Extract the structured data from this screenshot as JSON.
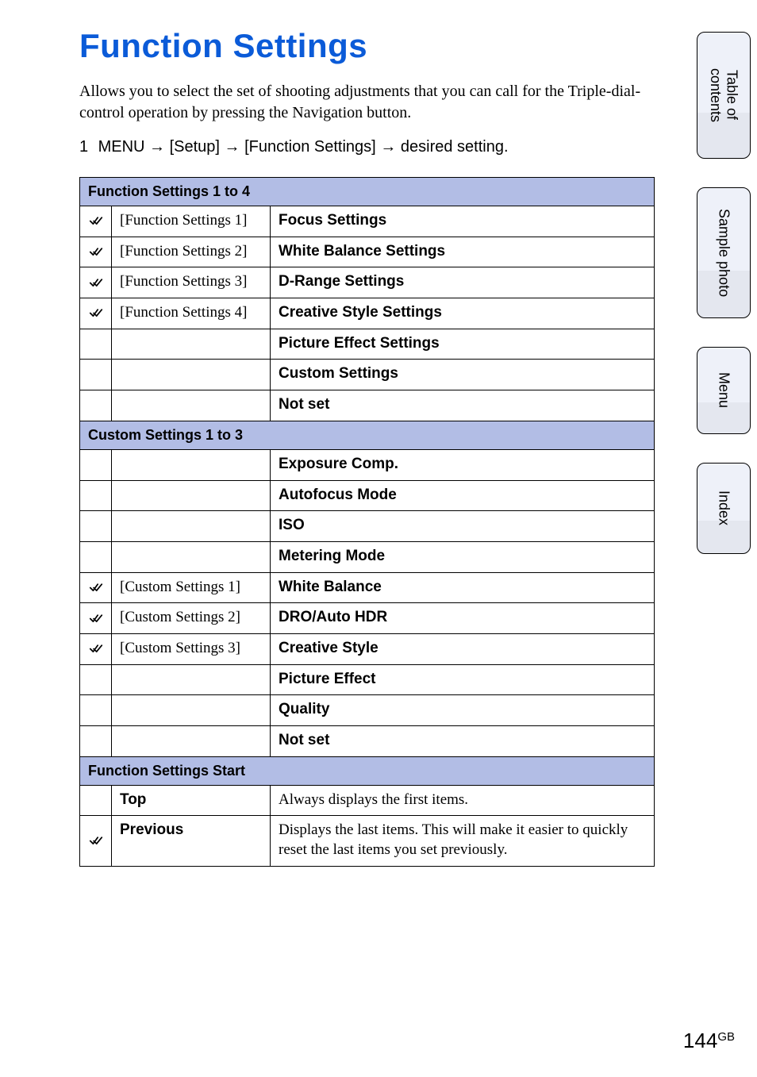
{
  "heading": "Function Settings",
  "intro": "Allows you to select the set of shooting adjustments that you can call for the Triple-dial-control operation by pressing the Navigation button.",
  "step": {
    "number": "1",
    "menu": "MENU",
    "arrow": "→",
    "setup": "[Setup]",
    "funcset": "[Function Settings]",
    "desired": "desired setting."
  },
  "sections": [
    {
      "title": "Function Settings 1 to 4",
      "rows": [
        {
          "check": true,
          "label": "[Function Settings 1]",
          "value": "Focus Settings",
          "label_style": "serif",
          "value_style": "bold"
        },
        {
          "check": true,
          "label": "[Function Settings 2]",
          "value": "White Balance Settings",
          "label_style": "serif",
          "value_style": "bold"
        },
        {
          "check": true,
          "label": "[Function Settings 3]",
          "value": "D-Range Settings",
          "label_style": "serif",
          "value_style": "bold"
        },
        {
          "check": true,
          "label": "[Function Settings 4]",
          "value": "Creative Style Settings",
          "label_style": "serif",
          "value_style": "bold"
        },
        {
          "check": false,
          "label": "",
          "value": "Picture Effect Settings",
          "label_style": "serif",
          "value_style": "bold"
        },
        {
          "check": false,
          "label": "",
          "value": "Custom Settings",
          "label_style": "serif",
          "value_style": "bold"
        },
        {
          "check": false,
          "label": "",
          "value": "Not set",
          "label_style": "serif",
          "value_style": "bold"
        }
      ]
    },
    {
      "title": "Custom Settings 1 to 3",
      "rows": [
        {
          "check": false,
          "label": "",
          "value": "Exposure Comp.",
          "label_style": "serif",
          "value_style": "bold"
        },
        {
          "check": false,
          "label": "",
          "value": "Autofocus Mode",
          "label_style": "serif",
          "value_style": "bold"
        },
        {
          "check": false,
          "label": "",
          "value": "ISO",
          "label_style": "serif",
          "value_style": "bold"
        },
        {
          "check": false,
          "label": "",
          "value": "Metering Mode",
          "label_style": "serif",
          "value_style": "bold"
        },
        {
          "check": true,
          "label": "[Custom Settings 1]",
          "value": "White Balance",
          "label_style": "serif",
          "value_style": "bold"
        },
        {
          "check": true,
          "label": "[Custom Settings 2]",
          "value": "DRO/Auto HDR",
          "label_style": "serif",
          "value_style": "bold"
        },
        {
          "check": true,
          "label": "[Custom Settings 3]",
          "value": "Creative Style",
          "label_style": "serif",
          "value_style": "bold"
        },
        {
          "check": false,
          "label": "",
          "value": "Picture Effect",
          "label_style": "serif",
          "value_style": "bold"
        },
        {
          "check": false,
          "label": "",
          "value": "Quality",
          "label_style": "serif",
          "value_style": "bold"
        },
        {
          "check": false,
          "label": "",
          "value": "Not set",
          "label_style": "serif",
          "value_style": "bold"
        }
      ]
    },
    {
      "title": "Function Settings Start",
      "rows": [
        {
          "check": false,
          "label": "Top",
          "value": "Always displays the first items.",
          "label_style": "bold",
          "value_style": "serif"
        },
        {
          "check": true,
          "label": "Previous",
          "value": "Displays the last items. This will make it easier to quickly reset the last items you set previously.",
          "label_style": "bold",
          "value_style": "serif"
        }
      ]
    }
  ],
  "side_tabs": [
    "Table of contents",
    "Sample photo",
    "Menu",
    "Index"
  ],
  "page_number": {
    "num": "144",
    "suffix": "GB"
  }
}
